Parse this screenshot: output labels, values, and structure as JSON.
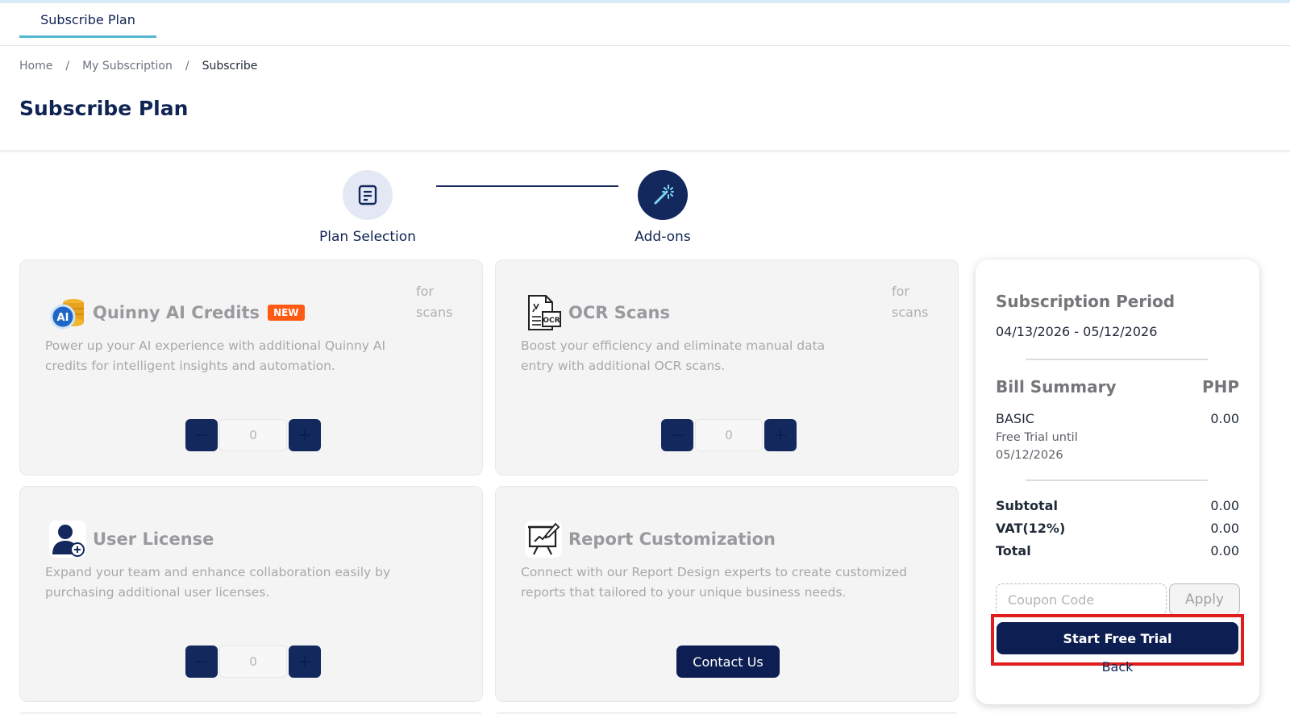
{
  "tab": {
    "label": "Subscribe Plan"
  },
  "breadcrumb": {
    "home": "Home",
    "sep1": "/",
    "my_subscription": "My Subscription",
    "sep2": "/",
    "current": "Subscribe"
  },
  "page_title": "Subscribe Plan",
  "steps": [
    {
      "label": "Plan Selection",
      "icon": "document-icon",
      "active": false
    },
    {
      "label": "Add-ons",
      "icon": "magic-wand-icon",
      "active": true
    }
  ],
  "addons": {
    "quinny": {
      "title": "Quinny AI Credits",
      "badge": "NEW",
      "unit_line1": "for",
      "unit_line2": "scans",
      "description": "Power up your AI experience with additional Quinny AI credits for intelligent insights and automation.",
      "minus": "−",
      "plus": "+",
      "qty": "0"
    },
    "ocr": {
      "title": "OCR Scans",
      "unit_line1": "for",
      "unit_line2": "scans",
      "description": "Boost your efficiency and eliminate manual data entry with additional OCR scans.",
      "minus": "−",
      "plus": "+",
      "qty": "0"
    },
    "user_license": {
      "title": "User License",
      "description": "Expand your team and enhance collaboration easily by purchasing additional user licenses.",
      "minus": "−",
      "plus": "+",
      "qty": "0"
    },
    "report": {
      "title": "Report Customization",
      "description": "Connect with our Report Design experts to create customized reports that tailored to your unique business needs.",
      "button": "Contact Us"
    }
  },
  "summary": {
    "period_title": "Subscription Period",
    "period_range": "04/13/2026 - 05/12/2026",
    "bill_title": "Bill Summary",
    "currency": "PHP",
    "plan_name": "BASIC",
    "plan_amount": "0.00",
    "trial_note_line1": "Free Trial until",
    "trial_note_line2": "05/12/2026",
    "subtotal_label": "Subtotal",
    "subtotal_value": "0.00",
    "vat_label": "VAT(12%)",
    "vat_value": "0.00",
    "total_label": "Total",
    "total_value": "0.00",
    "coupon_placeholder": "Coupon Code",
    "apply_label": "Apply",
    "start_trial_label": "Start Free Trial",
    "back_label": "Back"
  },
  "colors": {
    "brand_navy": "#0d1f52",
    "accent_blue": "#55b8d3",
    "badge_orange": "#ff5a14",
    "highlight_red": "#e11d1d"
  }
}
